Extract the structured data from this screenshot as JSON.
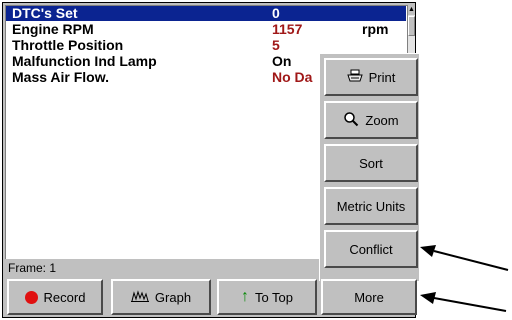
{
  "list": {
    "rows": [
      {
        "name": "DTC's Set",
        "value": "0",
        "unit": ""
      },
      {
        "name": "Engine RPM",
        "value": "1157",
        "unit": "rpm"
      },
      {
        "name": "Throttle Position",
        "value": "5",
        "unit": ""
      },
      {
        "name": "Malfunction Ind Lamp",
        "value": "On",
        "unit": ""
      },
      {
        "name": "Mass Air Flow.",
        "value": "No Da",
        "unit": ""
      }
    ],
    "selected_index": 0
  },
  "status": {
    "frame": "Frame: 1"
  },
  "popup_menu": {
    "items": [
      {
        "label": "Print",
        "icon": "printer-icon"
      },
      {
        "label": "Zoom",
        "icon": "magnifier-icon"
      },
      {
        "label": "Sort",
        "icon": ""
      },
      {
        "label": "Metric Units",
        "icon": ""
      },
      {
        "label": "Conflict",
        "icon": ""
      }
    ]
  },
  "toolbar": {
    "buttons": [
      {
        "label": "Record",
        "icon": "record-dot-icon"
      },
      {
        "label": "Graph",
        "icon": "graph-icon"
      },
      {
        "label": "To Top",
        "icon": "up-arrow-icon"
      },
      {
        "label": "More",
        "icon": ""
      }
    ]
  },
  "colors": {
    "selection": "#0b2491",
    "value_red": "#a01818",
    "record_red": "#e01010",
    "arrow_green": "#0a8a0a"
  }
}
